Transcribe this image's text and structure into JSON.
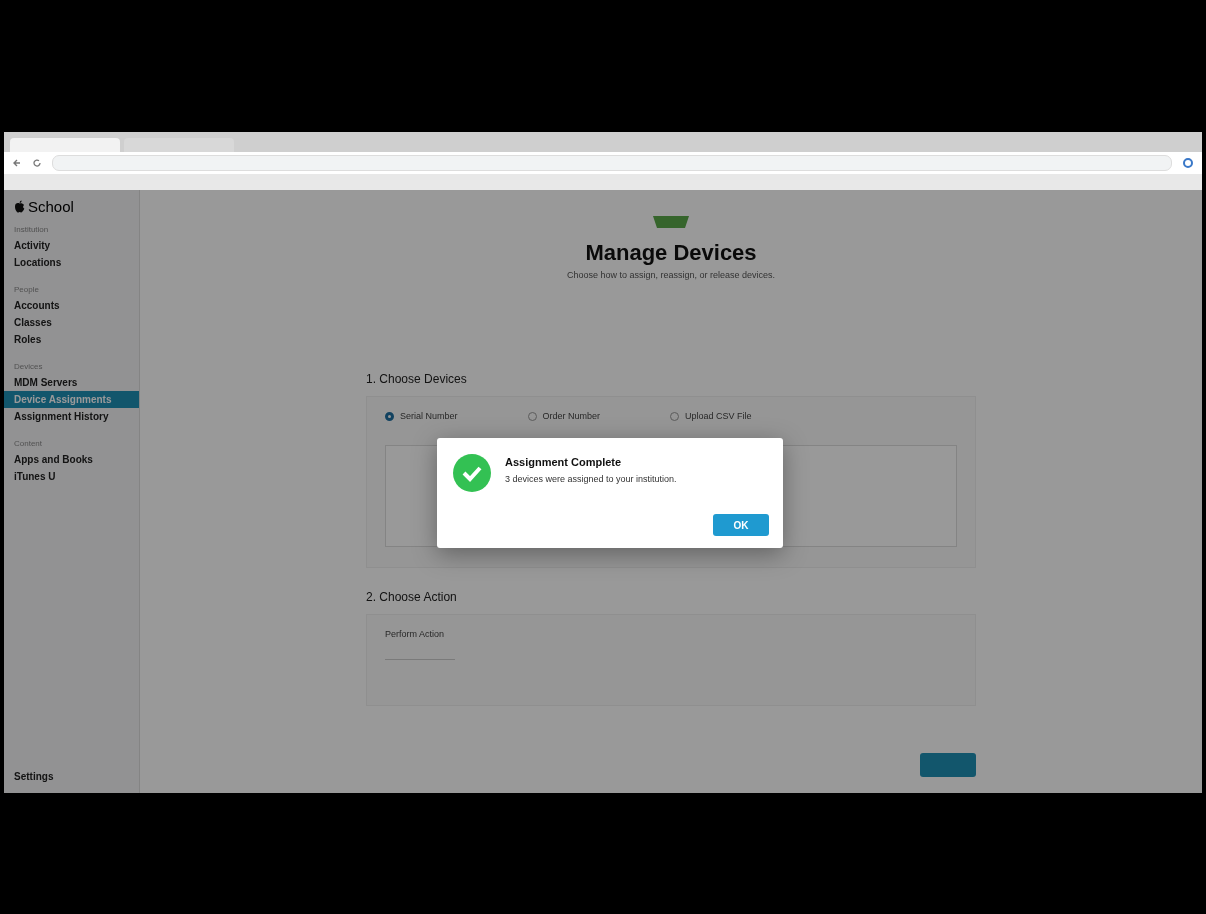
{
  "browser": {
    "tabs": [
      {
        "selected": true
      },
      {
        "selected": false
      }
    ]
  },
  "sidebar": {
    "brand": "School",
    "groups": [
      {
        "heading": "Institution",
        "items": [
          {
            "label": "Activity",
            "selected": false
          },
          {
            "label": "Locations",
            "selected": false
          }
        ]
      },
      {
        "heading": "People",
        "items": [
          {
            "label": "Accounts",
            "selected": false
          },
          {
            "label": "Classes",
            "selected": false
          },
          {
            "label": "Roles",
            "selected": false
          }
        ]
      },
      {
        "heading": "Devices",
        "items": [
          {
            "label": "MDM Servers",
            "selected": false
          },
          {
            "label": "Device Assignments",
            "selected": true
          },
          {
            "label": "Assignment History",
            "selected": false
          }
        ]
      },
      {
        "heading": "Content",
        "items": [
          {
            "label": "Apps and Books",
            "selected": false
          },
          {
            "label": "iTunes U",
            "selected": false
          }
        ]
      }
    ],
    "footer": "Settings"
  },
  "main": {
    "title": "Manage Devices",
    "subtitle": "Choose how to assign, reassign, or release devices.",
    "step1": {
      "heading": "1. Choose Devices",
      "options": [
        {
          "label": "Serial Number",
          "selected": true
        },
        {
          "label": "Order Number",
          "selected": false
        },
        {
          "label": "Upload CSV File",
          "selected": false
        }
      ]
    },
    "step2": {
      "heading": "2. Choose Action",
      "field_label": "Perform Action"
    }
  },
  "dialog": {
    "title": "Assignment Complete",
    "message": "3 devices were assigned to your institution.",
    "button": "OK"
  }
}
